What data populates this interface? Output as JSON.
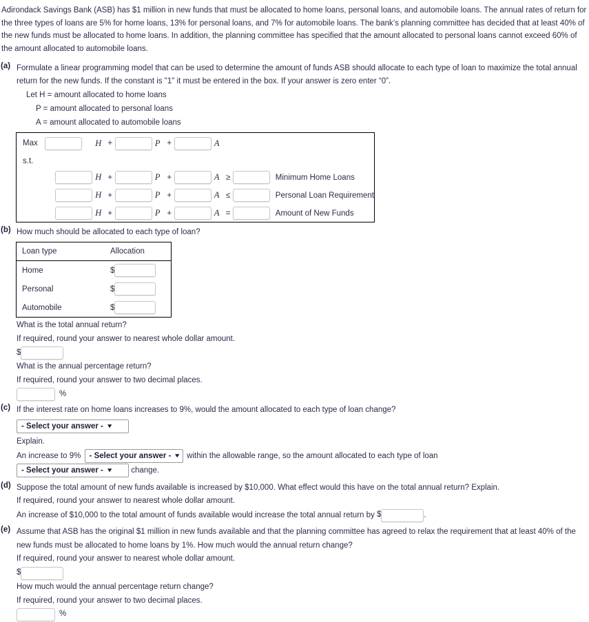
{
  "intro": "Adirondack Savings Bank (ASB) has $1 million in new funds that must be allocated to home loans, personal loans, and automobile loans. The annual rates of return for the three types of loans are 5% for home loans, 13% for personal loans, and 7% for automobile loans. The bank’s planning committee has decided that at least 40% of the new funds must be allocated to home loans. In addition, the planning committee has specified that the amount allocated to personal loans cannot exceed 60% of the amount allocated to automobile loans.",
  "parts": {
    "a": {
      "label": "(a)",
      "prompt": "Formulate a linear programming model that can be used to determine the amount of funds ASB should allocate to each type of loan to maximize the total annual return for the new funds. If the constant is \"1\" it must be entered in the box. If your answer is zero enter “0”.",
      "definitions": [
        "Let H = amount allocated to home loans",
        "P = amount allocated to personal loans",
        "A = amount allocated to automobile loans"
      ],
      "model": {
        "objective_label": "Max",
        "subject_to_label": "s.t.",
        "variables": [
          "H",
          "P",
          "A"
        ],
        "plus": "+",
        "objective_inputs": [
          "",
          "",
          ""
        ],
        "constraints": [
          {
            "coefficients": [
              "",
              "",
              ""
            ],
            "relation": "≥",
            "rhs": "",
            "description": "Minimum Home Loans"
          },
          {
            "coefficients": [
              "",
              "",
              ""
            ],
            "relation": "≤",
            "rhs": "",
            "description": "Personal Loan Requirement"
          },
          {
            "coefficients": [
              "",
              "",
              ""
            ],
            "relation": "=",
            "rhs": "",
            "description": "Amount of New Funds"
          }
        ]
      }
    },
    "b": {
      "label": "(b)",
      "prompt": "How much should be allocated to each type of loan?",
      "table": {
        "headers": [
          "Loan type",
          "Allocation"
        ],
        "currency_symbol": "$",
        "rows": [
          {
            "loan_type": "Home",
            "allocation": ""
          },
          {
            "loan_type": "Personal",
            "allocation": ""
          },
          {
            "loan_type": "Automobile",
            "allocation": ""
          }
        ]
      },
      "total_return_question": "What is the total annual return?",
      "total_return_rounding": "If required, round your answer to nearest whole dollar amount.",
      "total_return_currency": "$",
      "total_return_value": "",
      "pct_return_question": "What is the annual percentage return?",
      "pct_return_rounding": "If required, round your answer to two decimal places.",
      "pct_return_value": "",
      "pct_sign": "%"
    },
    "c": {
      "label": "(c)",
      "prompt": "If the interest rate on home loans increases to 9%, would the amount allocated to each type of loan change?",
      "select_main": "- Select your answer -",
      "explain_label": "Explain.",
      "explain_prefix": "An increase to 9%",
      "select_range": "- Select your answer -",
      "explain_middle": "within the allowable range, so the amount allocated to each type of loan",
      "select_change": "- Select your answer -",
      "explain_suffix": "change.",
      "caret": "⌄"
    },
    "d": {
      "label": "(d)",
      "prompt": "Suppose the total amount of new funds available is increased by $10,000. What effect would this have on the total annual return? Explain.",
      "rounding": "If required, round your answer to nearest whole dollar amount.",
      "answer_prefix": "An increase of $10,000 to the total amount of funds available would increase the total annual return by",
      "currency_symbol": "$",
      "answer_value": "",
      "answer_suffix": "."
    },
    "e": {
      "label": "(e)",
      "prompt": "Assume that ASB has the original $1 million in new funds available and that the planning committee has agreed to relax the requirement that at least 40% of the new funds must be allocated to home loans by 1%. How much would the annual return change?",
      "rounding_dollar": "If required, round your answer to nearest whole dollar amount.",
      "currency_symbol": "$",
      "dollar_value": "",
      "pct_question": "How much would the annual percentage return change?",
      "rounding_pct": "If required, round your answer to two decimal places.",
      "pct_value": "",
      "pct_sign": "%"
    }
  },
  "colors": {
    "text": "#2b2b4a",
    "border": "#000000",
    "input_border": "#c6c6c6",
    "select_border": "#9a9a9a"
  }
}
